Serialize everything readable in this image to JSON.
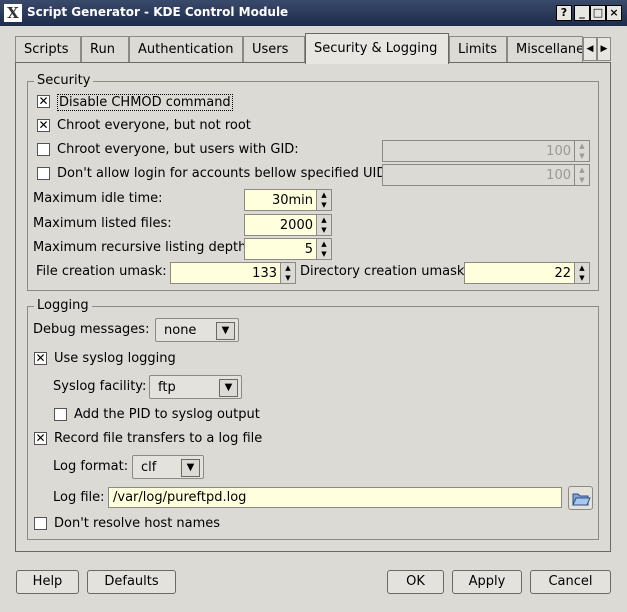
{
  "window": {
    "title": "Script Generator - KDE Control Module",
    "controls": [
      "?",
      "_",
      "□",
      "×"
    ]
  },
  "tabs": [
    "Scripts",
    "Run",
    "Authentication",
    "Users",
    "Security & Logging",
    "Limits",
    "Miscellane"
  ],
  "active_tab": "Security & Logging",
  "security": {
    "legend": "Security",
    "disable_chmod": {
      "label": "Disable CHMOD command",
      "checked": true
    },
    "chroot_everyone": {
      "label": "Chroot everyone, but not root",
      "checked": true
    },
    "chroot_gid": {
      "label": "Chroot everyone, but users with GID:",
      "checked": false,
      "value": "100"
    },
    "deny_uid": {
      "label": "Don't allow login for accounts bellow specified UID:",
      "checked": false,
      "value": "100"
    },
    "max_idle": {
      "label": "Maximum idle time:",
      "value": "30min"
    },
    "max_files": {
      "label": "Maximum listed files:",
      "value": "2000"
    },
    "max_depth": {
      "label": "Maximum recursive listing depth:",
      "value": "5"
    },
    "file_umask": {
      "label": "File creation umask:",
      "value": "133"
    },
    "dir_umask": {
      "label": "Directory creation umask:",
      "value": "22"
    }
  },
  "logging": {
    "legend": "Logging",
    "debug": {
      "label": "Debug messages:",
      "value": "none"
    },
    "syslog": {
      "label": "Use syslog logging",
      "checked": true
    },
    "facility": {
      "label": "Syslog facility:",
      "value": "ftp"
    },
    "add_pid": {
      "label": "Add the PID to syslog output",
      "checked": false
    },
    "record": {
      "label": "Record file transfers to a log file",
      "checked": true
    },
    "log_format": {
      "label": "Log format:",
      "value": "clf"
    },
    "log_file": {
      "label": "Log file:",
      "value": "/var/log/pureftpd.log"
    },
    "no_resolve": {
      "label": "Don't resolve host names",
      "checked": false
    }
  },
  "buttons": {
    "help": "Help",
    "defaults": "Defaults",
    "ok": "OK",
    "apply": "Apply",
    "cancel": "Cancel"
  }
}
